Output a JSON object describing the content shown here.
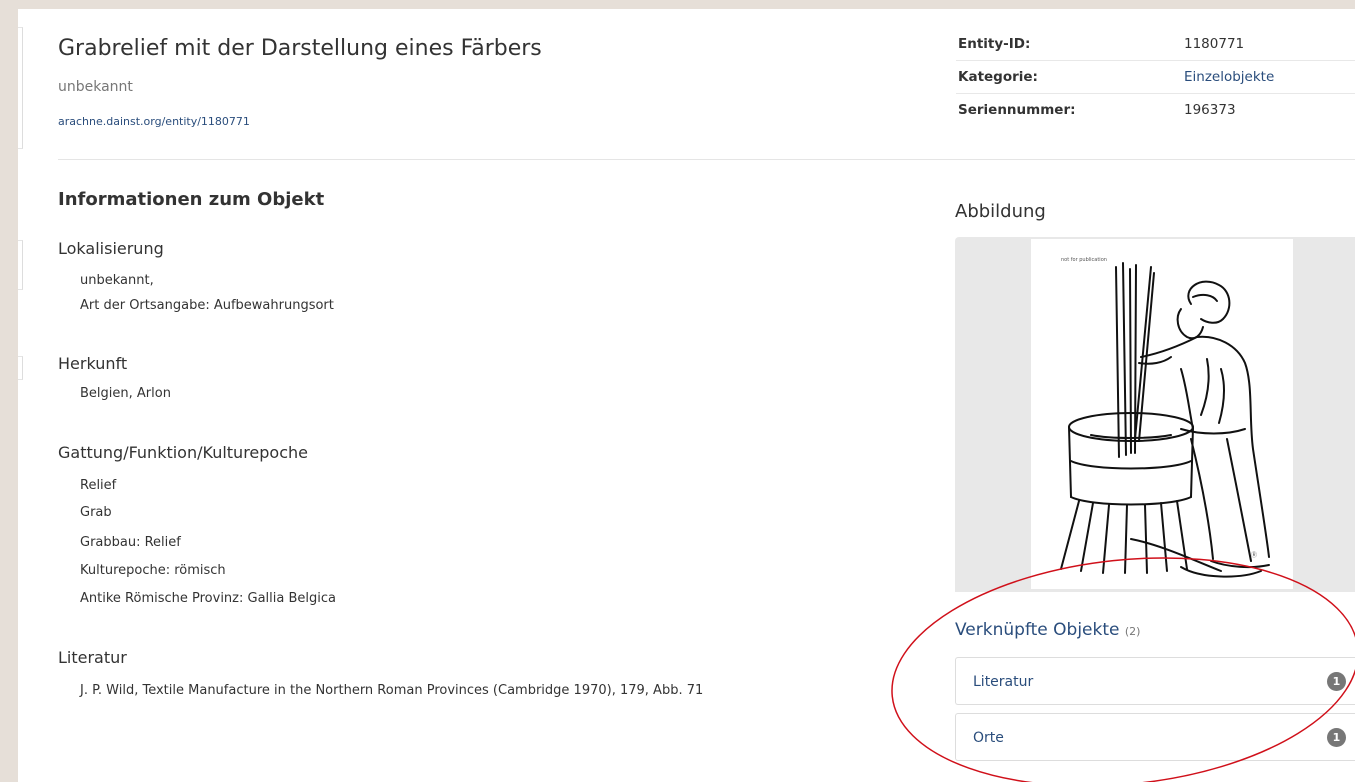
{
  "object": {
    "title": "Grabrelief mit der Darstellung eines Färbers",
    "subtitle": "unbekannt",
    "uri": "arachne.dainst.org/entity/1180771"
  },
  "meta": [
    {
      "key": "Entity-ID:",
      "value": "1180771",
      "link": false
    },
    {
      "key": "Kategorie:",
      "value": "Einzelobjekte",
      "link": true
    },
    {
      "key": "Seriennummer:",
      "value": "196373",
      "link": false
    }
  ],
  "info": {
    "heading": "Informationen zum Objekt",
    "sections": [
      {
        "title": "Lokalisierung",
        "lines": [
          "unbekannt,",
          "Art der Ortsangabe: Aufbewahrungsort"
        ]
      },
      {
        "title": "Herkunft",
        "lines": [
          "Belgien, Arlon"
        ]
      },
      {
        "title": "Gattung/Funktion/Kulturepoche",
        "lines": [
          "Relief",
          "Grab",
          "Grabbau: Relief",
          "Kulturepoche: römisch",
          "Antike Römische Provinz: Gallia Belgica"
        ]
      },
      {
        "title": "Literatur",
        "lines": [
          "J. P. Wild, Textile Manufacture in the Northern Roman Provinces (Cambridge 1970), 179, Abb. 71"
        ]
      }
    ]
  },
  "abbildung": {
    "heading": "Abbildung",
    "image_alt": "line-drawing-dyer-relief"
  },
  "verknuepfte": {
    "heading": "Verknüpfte Objekte",
    "count": "(2)",
    "items": [
      {
        "label": "Literatur",
        "badge": "1"
      },
      {
        "label": "Orte",
        "badge": "1"
      }
    ]
  },
  "colors": {
    "link": "#2a4d7c",
    "annotation": "#d0101a",
    "background": "#e6dfd8"
  }
}
